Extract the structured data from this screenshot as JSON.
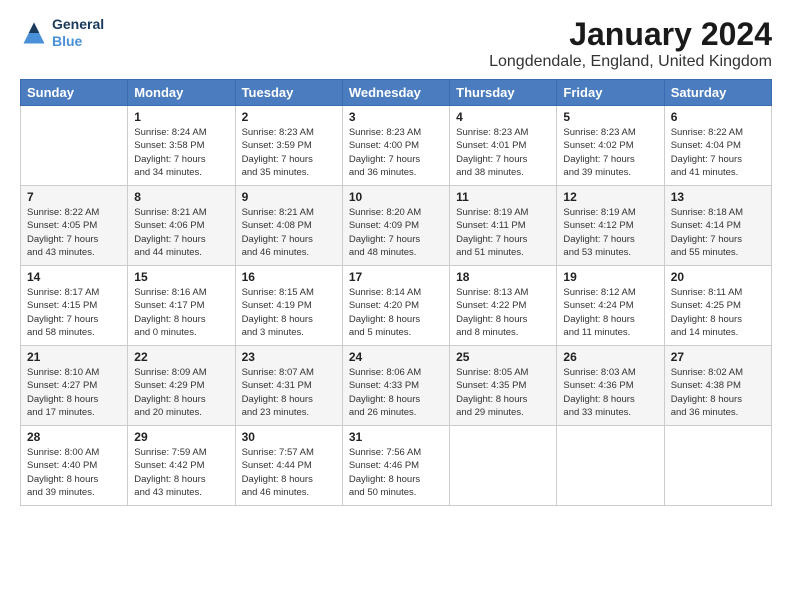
{
  "logo": {
    "line1": "General",
    "line2": "Blue"
  },
  "title": "January 2024",
  "subtitle": "Longdendale, England, United Kingdom",
  "days_header": [
    "Sunday",
    "Monday",
    "Tuesday",
    "Wednesday",
    "Thursday",
    "Friday",
    "Saturday"
  ],
  "weeks": [
    [
      {
        "day": "",
        "info": ""
      },
      {
        "day": "1",
        "info": "Sunrise: 8:24 AM\nSunset: 3:58 PM\nDaylight: 7 hours\nand 34 minutes."
      },
      {
        "day": "2",
        "info": "Sunrise: 8:23 AM\nSunset: 3:59 PM\nDaylight: 7 hours\nand 35 minutes."
      },
      {
        "day": "3",
        "info": "Sunrise: 8:23 AM\nSunset: 4:00 PM\nDaylight: 7 hours\nand 36 minutes."
      },
      {
        "day": "4",
        "info": "Sunrise: 8:23 AM\nSunset: 4:01 PM\nDaylight: 7 hours\nand 38 minutes."
      },
      {
        "day": "5",
        "info": "Sunrise: 8:23 AM\nSunset: 4:02 PM\nDaylight: 7 hours\nand 39 minutes."
      },
      {
        "day": "6",
        "info": "Sunrise: 8:22 AM\nSunset: 4:04 PM\nDaylight: 7 hours\nand 41 minutes."
      }
    ],
    [
      {
        "day": "7",
        "info": "Sunrise: 8:22 AM\nSunset: 4:05 PM\nDaylight: 7 hours\nand 43 minutes."
      },
      {
        "day": "8",
        "info": "Sunrise: 8:21 AM\nSunset: 4:06 PM\nDaylight: 7 hours\nand 44 minutes."
      },
      {
        "day": "9",
        "info": "Sunrise: 8:21 AM\nSunset: 4:08 PM\nDaylight: 7 hours\nand 46 minutes."
      },
      {
        "day": "10",
        "info": "Sunrise: 8:20 AM\nSunset: 4:09 PM\nDaylight: 7 hours\nand 48 minutes."
      },
      {
        "day": "11",
        "info": "Sunrise: 8:19 AM\nSunset: 4:11 PM\nDaylight: 7 hours\nand 51 minutes."
      },
      {
        "day": "12",
        "info": "Sunrise: 8:19 AM\nSunset: 4:12 PM\nDaylight: 7 hours\nand 53 minutes."
      },
      {
        "day": "13",
        "info": "Sunrise: 8:18 AM\nSunset: 4:14 PM\nDaylight: 7 hours\nand 55 minutes."
      }
    ],
    [
      {
        "day": "14",
        "info": "Sunrise: 8:17 AM\nSunset: 4:15 PM\nDaylight: 7 hours\nand 58 minutes."
      },
      {
        "day": "15",
        "info": "Sunrise: 8:16 AM\nSunset: 4:17 PM\nDaylight: 8 hours\nand 0 minutes."
      },
      {
        "day": "16",
        "info": "Sunrise: 8:15 AM\nSunset: 4:19 PM\nDaylight: 8 hours\nand 3 minutes."
      },
      {
        "day": "17",
        "info": "Sunrise: 8:14 AM\nSunset: 4:20 PM\nDaylight: 8 hours\nand 5 minutes."
      },
      {
        "day": "18",
        "info": "Sunrise: 8:13 AM\nSunset: 4:22 PM\nDaylight: 8 hours\nand 8 minutes."
      },
      {
        "day": "19",
        "info": "Sunrise: 8:12 AM\nSunset: 4:24 PM\nDaylight: 8 hours\nand 11 minutes."
      },
      {
        "day": "20",
        "info": "Sunrise: 8:11 AM\nSunset: 4:25 PM\nDaylight: 8 hours\nand 14 minutes."
      }
    ],
    [
      {
        "day": "21",
        "info": "Sunrise: 8:10 AM\nSunset: 4:27 PM\nDaylight: 8 hours\nand 17 minutes."
      },
      {
        "day": "22",
        "info": "Sunrise: 8:09 AM\nSunset: 4:29 PM\nDaylight: 8 hours\nand 20 minutes."
      },
      {
        "day": "23",
        "info": "Sunrise: 8:07 AM\nSunset: 4:31 PM\nDaylight: 8 hours\nand 23 minutes."
      },
      {
        "day": "24",
        "info": "Sunrise: 8:06 AM\nSunset: 4:33 PM\nDaylight: 8 hours\nand 26 minutes."
      },
      {
        "day": "25",
        "info": "Sunrise: 8:05 AM\nSunset: 4:35 PM\nDaylight: 8 hours\nand 29 minutes."
      },
      {
        "day": "26",
        "info": "Sunrise: 8:03 AM\nSunset: 4:36 PM\nDaylight: 8 hours\nand 33 minutes."
      },
      {
        "day": "27",
        "info": "Sunrise: 8:02 AM\nSunset: 4:38 PM\nDaylight: 8 hours\nand 36 minutes."
      }
    ],
    [
      {
        "day": "28",
        "info": "Sunrise: 8:00 AM\nSunset: 4:40 PM\nDaylight: 8 hours\nand 39 minutes."
      },
      {
        "day": "29",
        "info": "Sunrise: 7:59 AM\nSunset: 4:42 PM\nDaylight: 8 hours\nand 43 minutes."
      },
      {
        "day": "30",
        "info": "Sunrise: 7:57 AM\nSunset: 4:44 PM\nDaylight: 8 hours\nand 46 minutes."
      },
      {
        "day": "31",
        "info": "Sunrise: 7:56 AM\nSunset: 4:46 PM\nDaylight: 8 hours\nand 50 minutes."
      },
      {
        "day": "",
        "info": ""
      },
      {
        "day": "",
        "info": ""
      },
      {
        "day": "",
        "info": ""
      }
    ]
  ]
}
